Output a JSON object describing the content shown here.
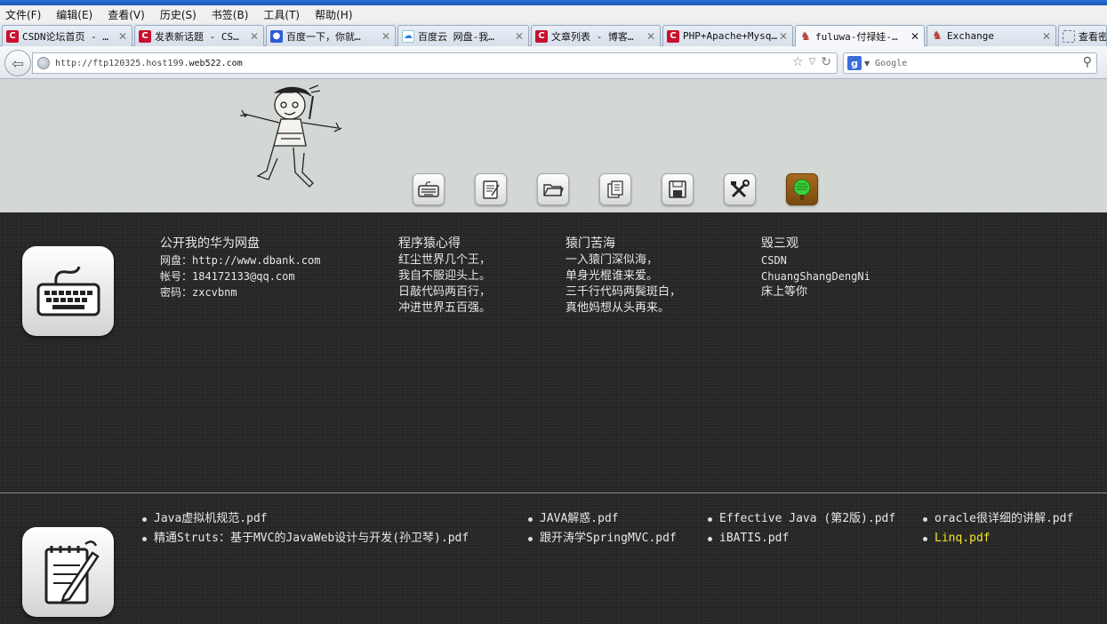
{
  "menu": [
    "文件(F)",
    "编辑(E)",
    "查看(V)",
    "历史(S)",
    "书签(B)",
    "工具(T)",
    "帮助(H)"
  ],
  "tabs": [
    {
      "label": "CSDN论坛首页 - …",
      "icon": "csdn-icon"
    },
    {
      "label": "发表新话题 - CS…",
      "icon": "csdn-icon"
    },
    {
      "label": "百度一下，你就…",
      "icon": "baidu-paw-icon"
    },
    {
      "label": "百度云 网盘-我…",
      "icon": "baidu-cloud-icon"
    },
    {
      "label": "文章列表 - 博客…",
      "icon": "csdn-icon"
    },
    {
      "label": "PHP+Apache+Mysq…",
      "icon": "csdn-icon"
    },
    {
      "label": "fuluwa-付禄娃-…",
      "icon": "fuluwa-icon",
      "active": true
    },
    {
      "label": "Exchange",
      "icon": "fuluwa-icon"
    },
    {
      "label": "查看密",
      "icon": "blank-page-icon"
    }
  ],
  "nav": {
    "url_prefix": "http://ftp120325.host199.",
    "url_host": "web522.com",
    "search_placeholder": "Google"
  },
  "toolbar_icons": [
    "keyboard-icon",
    "notepad-icon",
    "folder-icon",
    "copy-icon",
    "save-icon",
    "tools-icon",
    "tree-icon"
  ],
  "columns": [
    {
      "heading": "公开我的华为网盘",
      "lines": [
        "网盘：http://www.dbank.com",
        "帐号：184172133@qq.com",
        "密码：zxcvbnm"
      ]
    },
    {
      "heading": "程序猿心得",
      "lines": [
        "红尘世界几个王，",
        "我自不服迎头上。",
        "日敲代码两百行，",
        "冲进世界五百强。"
      ]
    },
    {
      "heading": "猿门苦海",
      "lines": [
        "一入猿门深似海，",
        "单身光棍谁来爱。",
        "三千行代码两鬓斑白，",
        "真他妈想从头再来。"
      ]
    },
    {
      "heading": "毁三观",
      "lines": [
        "CSDN",
        "ChuangShangDengNi",
        "床上等你"
      ]
    }
  ],
  "files": {
    "col1": [
      "Java虚拟机规范.pdf",
      "精通Struts：基于MVC的JavaWeb设计与开发(孙卫琴).pdf"
    ],
    "col2": [
      "JAVA解惑.pdf",
      "跟开涛学SpringMVC.pdf"
    ],
    "col3": [
      "Effective Java (第2版).pdf",
      "iBATIS.pdf"
    ],
    "col4": [
      "oracle很详细的讲解.pdf",
      "Linq.pdf"
    ]
  },
  "colors": {
    "highlight": "#f3e623",
    "dark_bg": "#262626",
    "header_bg": "#d4d8d4"
  }
}
